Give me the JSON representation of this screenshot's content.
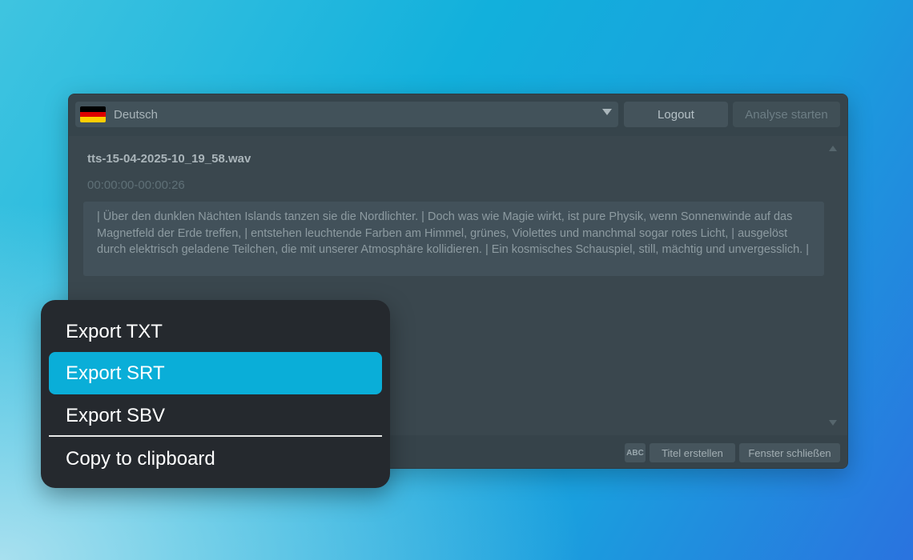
{
  "toolbar": {
    "language": "Deutsch",
    "flag_colors": [
      "#000000",
      "#dd0000",
      "#ffce00"
    ],
    "logout_label": "Logout",
    "analyse_label": "Analyse starten"
  },
  "content": {
    "filename": "tts-15-04-2025-10_19_58.wav",
    "timecode": "00:00:00-00:00:26",
    "transcript": "| Über den dunklen Nächten Islands tanzen sie die Nordlichter. | Doch was wie Magie wirkt, ist pure Physik, wenn Sonnenwinde auf das Magnetfeld der Erde treffen, | entstehen leuchtende Farben am Himmel, grünes, Violettes und manchmal sogar rotes Licht, | ausgelöst durch elektrisch geladene Teilchen, die mit unserer Atmosphäre kollidieren. | Ein kosmisches Schauspiel, still, mächtig und unvergesslich. |"
  },
  "statusbar": {
    "abc_label": "ABC",
    "titel_label": "Titel erstellen",
    "close_label": "Fenster schließen"
  },
  "menu": {
    "items": [
      {
        "label": "Export TXT"
      },
      {
        "label": "Export SRT"
      },
      {
        "label": "Export SBV"
      },
      {
        "label": "Copy to clipboard"
      }
    ],
    "active_color": "#0aaed8"
  }
}
